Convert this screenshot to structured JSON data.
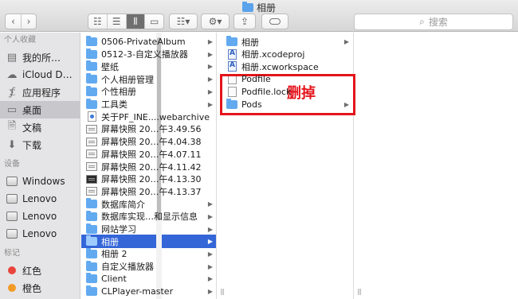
{
  "window": {
    "title": "相册"
  },
  "toolbar": {
    "back_icon": "chevron-left",
    "forward_icon": "chevron-right",
    "search_placeholder": "搜索"
  },
  "sidebar": {
    "favorites_header": "个人收藏",
    "favorites": [
      {
        "label": "我的所…",
        "icon": "documents-icon"
      },
      {
        "label": "iCloud D…",
        "icon": "cloud-icon"
      },
      {
        "label": "应用程序",
        "icon": "apps-icon"
      },
      {
        "label": "桌面",
        "icon": "desktop-icon",
        "selected": true
      },
      {
        "label": "文稿",
        "icon": "document-icon"
      },
      {
        "label": "下载",
        "icon": "download-icon"
      }
    ],
    "devices_header": "设备",
    "devices": [
      {
        "label": "Windows"
      },
      {
        "label": "Lenovo"
      },
      {
        "label": "Lenovo"
      },
      {
        "label": "Lenovo"
      }
    ],
    "tags_header": "标记",
    "tags": [
      {
        "label": "红色",
        "color": "#e8453c"
      },
      {
        "label": "橙色",
        "color": "#f39a26"
      }
    ]
  },
  "column1": {
    "items": [
      {
        "label": "0506-PrivateAlbum",
        "kind": "folder",
        "arrow": true
      },
      {
        "label": "0512-3-自定义播放器",
        "kind": "folder",
        "arrow": true
      },
      {
        "label": "壁纸",
        "kind": "folder",
        "arrow": true
      },
      {
        "label": "个人相册管理",
        "kind": "folder",
        "arrow": true
      },
      {
        "label": "个性相册",
        "kind": "folder",
        "arrow": true
      },
      {
        "label": "工具类",
        "kind": "folder",
        "arrow": true
      },
      {
        "label": "关于PF_INE....webarchive",
        "kind": "web",
        "arrow": false
      },
      {
        "label": "屏幕快照 20…午3.49.56",
        "kind": "shot",
        "arrow": false
      },
      {
        "label": "屏幕快照 20…午4.04.38",
        "kind": "shot",
        "arrow": false
      },
      {
        "label": "屏幕快照 20…午4.07.11",
        "kind": "shot",
        "arrow": false
      },
      {
        "label": "屏幕快照 20…午4.11.42",
        "kind": "shot",
        "arrow": false
      },
      {
        "label": "屏幕快照 20…午4.13.30",
        "kind": "shot-dark",
        "arrow": false
      },
      {
        "label": "屏幕快照 20…午4.13.37",
        "kind": "shot",
        "arrow": false
      },
      {
        "label": "数据库简介",
        "kind": "folder",
        "arrow": true
      },
      {
        "label": "数据库实现…和显示信息",
        "kind": "folder",
        "arrow": true
      },
      {
        "label": "网站学习",
        "kind": "folder",
        "arrow": true
      },
      {
        "label": "相册",
        "kind": "folder",
        "arrow": true,
        "selected": true
      },
      {
        "label": "相册 2",
        "kind": "folder",
        "arrow": true
      },
      {
        "label": "自定义播放器",
        "kind": "folder",
        "arrow": true
      },
      {
        "label": "Client",
        "kind": "folder",
        "arrow": true
      },
      {
        "label": "CLPlayer-master",
        "kind": "folder",
        "arrow": true
      }
    ]
  },
  "column2": {
    "items": [
      {
        "label": "相册",
        "kind": "folder",
        "arrow": true
      },
      {
        "label": "相册.xcodeproj",
        "kind": "xcode",
        "arrow": false
      },
      {
        "label": "相册.xcworkspace",
        "kind": "xcode",
        "arrow": false
      },
      {
        "label": "Podfile",
        "kind": "doc",
        "arrow": false
      },
      {
        "label": "Podfile.lock",
        "kind": "doc",
        "arrow": false
      },
      {
        "label": "Pods",
        "kind": "folder",
        "arrow": true
      }
    ]
  },
  "annotation": {
    "text": "删掉",
    "color": "#e4141b"
  },
  "colors": {
    "selection": "#3466d8",
    "folder": "#62aaf0"
  }
}
